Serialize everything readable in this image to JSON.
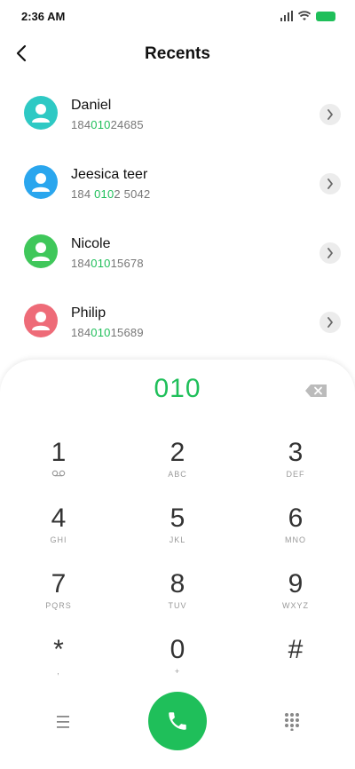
{
  "status": {
    "time": "2:36 AM"
  },
  "header": {
    "title": "Recents"
  },
  "contacts": [
    {
      "name": "Daniel",
      "number_pre": "184",
      "number_hl": "010",
      "number_post": "24685",
      "avatar_color": "#2ec9c4"
    },
    {
      "name": "Jeesica teer",
      "number_pre": "184 ",
      "number_hl": "010",
      "number_post": "2 5042",
      "avatar_color": "#2aa6ee"
    },
    {
      "name": "Nicole",
      "number_pre": "184",
      "number_hl": "010",
      "number_post": "15678",
      "avatar_color": "#3fc75a"
    },
    {
      "name": "Philip",
      "number_pre": "184",
      "number_hl": "010",
      "number_post": "15689",
      "avatar_color": "#ee6b78"
    }
  ],
  "dialpad": {
    "input": "010",
    "keys": [
      {
        "digit": "1",
        "letters": ""
      },
      {
        "digit": "2",
        "letters": "ABC"
      },
      {
        "digit": "3",
        "letters": "DEF"
      },
      {
        "digit": "4",
        "letters": "GHI"
      },
      {
        "digit": "5",
        "letters": "JKL"
      },
      {
        "digit": "6",
        "letters": "MNO"
      },
      {
        "digit": "7",
        "letters": "PQRS"
      },
      {
        "digit": "8",
        "letters": "TUV"
      },
      {
        "digit": "9",
        "letters": "WXYZ"
      },
      {
        "digit": "*",
        "letters": ","
      },
      {
        "digit": "0",
        "letters": "+"
      },
      {
        "digit": "#",
        "letters": ""
      }
    ]
  },
  "colors": {
    "accent": "#1fbf5a",
    "chevron_bg": "#ececec"
  }
}
